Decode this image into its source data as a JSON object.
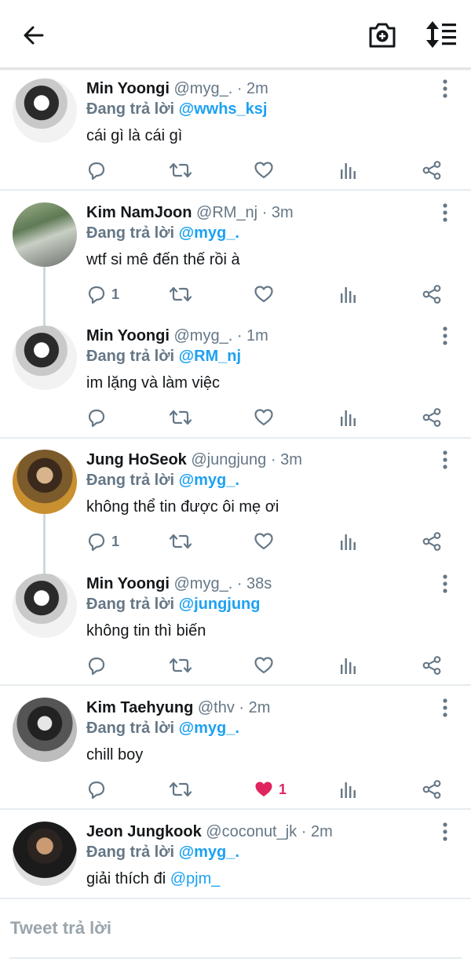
{
  "header": {
    "back_icon": "arrow-left-icon",
    "camera_icon": "camera-plus-icon",
    "sort_icon": "sort-icon"
  },
  "tweets": [
    {
      "name": "Min Yoongi",
      "handle": "@myg_.",
      "time": "· 2m",
      "reply_label": "Đang trả lời",
      "reply_to": "@wwhs_ksj",
      "text": "cái gì là cái gì",
      "text_mention": "",
      "replies": "",
      "likes": "",
      "liked": false
    },
    {
      "name": "Kim NamJoon",
      "handle": "@RM_nj",
      "time": "· 3m",
      "reply_label": "Đang trả lời",
      "reply_to": "@myg_.",
      "text": "wtf si mê đến thế rồi à",
      "text_mention": "",
      "replies": "1",
      "likes": "",
      "liked": false
    },
    {
      "name": "Min Yoongi",
      "handle": "@myg_.",
      "time": "· 1m",
      "reply_label": "Đang trả lời",
      "reply_to": "@RM_nj",
      "text": "im lặng và làm việc",
      "text_mention": "",
      "replies": "",
      "likes": "",
      "liked": false
    },
    {
      "name": "Jung HoSeok",
      "handle": "@jungjung",
      "time": "· 3m",
      "reply_label": "Đang trả lời",
      "reply_to": "@myg_.",
      "text": "không thể tin được ôi mẹ ơi",
      "text_mention": "",
      "replies": "1",
      "likes": "",
      "liked": false
    },
    {
      "name": "Min Yoongi",
      "handle": "@myg_.",
      "time": "· 38s",
      "reply_label": "Đang trả lời",
      "reply_to": "@jungjung",
      "text": "không tin thì biến",
      "text_mention": "",
      "replies": "",
      "likes": "",
      "liked": false
    },
    {
      "name": "Kim Taehyung",
      "handle": "@thv",
      "time": "· 2m",
      "reply_label": "Đang trả lời",
      "reply_to": "@myg_.",
      "text": "chill boy",
      "text_mention": "",
      "replies": "",
      "likes": "1",
      "liked": true
    },
    {
      "name": "Jeon Jungkook",
      "handle": "@coconut_jk",
      "time": "· 2m",
      "reply_label": "Đang trả lời",
      "reply_to": "@myg_.",
      "text": "giải thích đi ",
      "text_mention": "@pjm_",
      "replies": "",
      "likes": "",
      "liked": false
    }
  ],
  "composer": {
    "placeholder": "Tweet trả lời"
  },
  "colors": {
    "accent": "#1da1f2",
    "secondary": "#657786",
    "like": "#e0245e",
    "divider": "#e6ecf0"
  }
}
